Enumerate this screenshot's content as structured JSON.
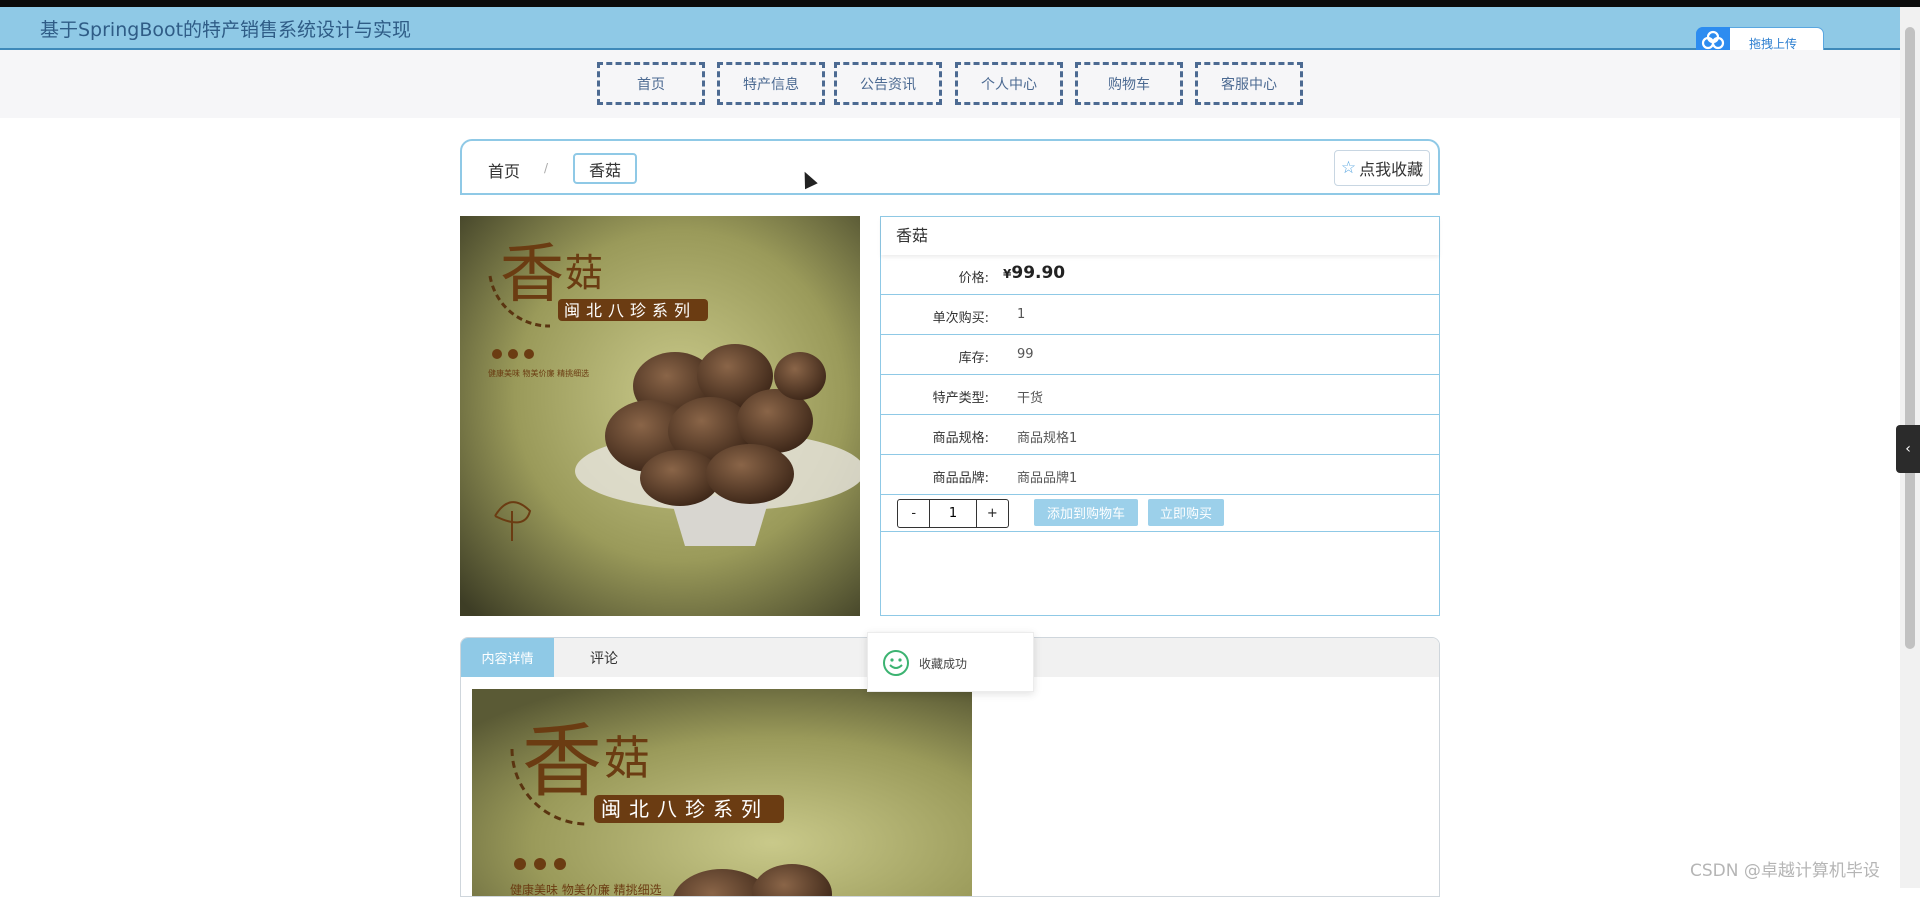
{
  "header": {
    "title": "基于SpringBoot的特产销售系统设计与实现",
    "upload_label": "拖拽上传"
  },
  "nav": {
    "items": [
      "首页",
      "特产信息",
      "公告资讯",
      "个人中心",
      "购物车",
      "客服中心"
    ]
  },
  "breadcrumb": {
    "home": "首页",
    "separator": "/",
    "current": "香菇"
  },
  "favorite_button": "点我收藏",
  "product": {
    "name": "香菇",
    "image_text": {
      "title_big": "香",
      "title_small": "菇",
      "series": "闽北八珍系列",
      "side_text": "健康美味 物美价廉 精挑细选"
    },
    "price_label": "价格:",
    "price_currency": "¥",
    "price_value": "99.90",
    "fields": [
      {
        "label": "单次购买:",
        "value": "1"
      },
      {
        "label": "库存:",
        "value": "99"
      },
      {
        "label": "特产类型:",
        "value": "干货"
      },
      {
        "label": "商品规格:",
        "value": "商品规格1"
      },
      {
        "label": "商品品牌:",
        "value": "商品品牌1"
      }
    ],
    "quantity": {
      "minus": "-",
      "value": "1",
      "plus": "+"
    },
    "add_to_cart": "添加到购物车",
    "buy_now": "立即购买"
  },
  "tabs": [
    {
      "label": "内容详情",
      "active": true
    },
    {
      "label": "评论",
      "active": false
    }
  ],
  "toast": {
    "message": "收藏成功"
  },
  "watermark": "CSDN @卓越计算机毕设",
  "colors": {
    "header_bg": "#8fc9e6",
    "accent": "#8fc9e6",
    "nav_border": "#4c6a92",
    "button_bg": "#9cd0ea"
  }
}
